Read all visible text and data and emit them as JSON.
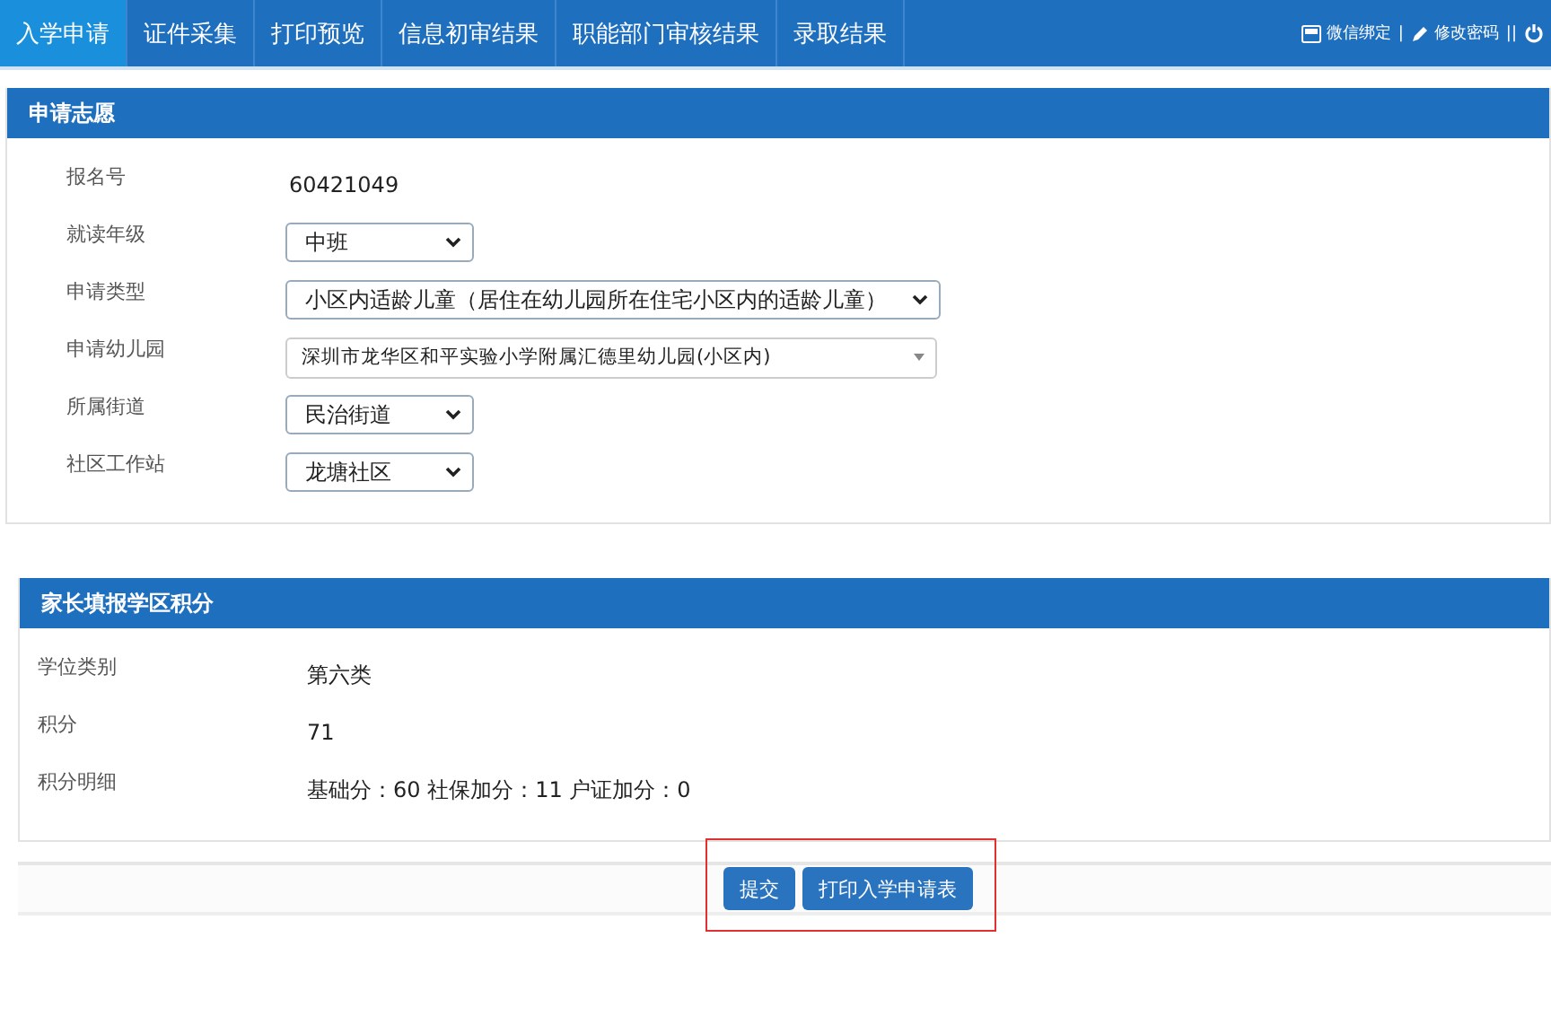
{
  "nav": {
    "tabs": [
      {
        "label": "入学申请",
        "selected": true
      },
      {
        "label": "证件采集",
        "selected": false
      },
      {
        "label": "打印预览",
        "selected": false
      },
      {
        "label": "信息初审结果",
        "selected": false
      },
      {
        "label": "职能部门审核结果",
        "selected": false
      },
      {
        "label": "录取结果",
        "selected": false
      }
    ],
    "links": [
      {
        "kind": "wechat",
        "label": "微信绑定"
      },
      {
        "kind": "separator",
        "label": "|"
      },
      {
        "kind": "edit",
        "label": "修改密码"
      },
      {
        "kind": "separator",
        "label": "||"
      },
      {
        "kind": "power"
      }
    ]
  },
  "panels": [
    {
      "title": "申请志愿",
      "rows": [
        {
          "label": "报名号",
          "kind": "text",
          "value": "60421049"
        },
        {
          "label": "就读年级",
          "kind": "select",
          "value": "中班"
        },
        {
          "label": "申请类型",
          "kind": "select",
          "value": "小区内适龄儿童（居住在幼儿园所在住宅小区内的适龄儿童）"
        },
        {
          "label": "申请幼儿园",
          "kind": "combo",
          "value": "深圳市龙华区和平实验小学附属汇德里幼儿园(小区内)"
        },
        {
          "label": "所属街道",
          "kind": "select",
          "value": "民治街道"
        },
        {
          "label": "社区工作站",
          "kind": "select",
          "value": "龙塘社区"
        }
      ]
    },
    {
      "title": "家长填报学区积分",
      "rows": [
        {
          "label": "学位类别",
          "kind": "text",
          "value": "第六类"
        },
        {
          "label": "积分",
          "kind": "text",
          "value": "71"
        },
        {
          "label": "积分明细",
          "kind": "text",
          "value": "基础分：60  社保加分：11  户证加分：0"
        }
      ]
    }
  ],
  "actions": {
    "highlighted": true,
    "buttons": [
      {
        "label": "提交"
      },
      {
        "label": "打印入学申请表"
      }
    ]
  }
}
